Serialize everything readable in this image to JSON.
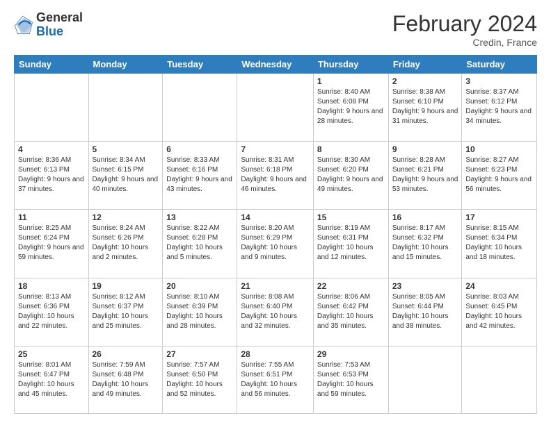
{
  "header": {
    "logo_general": "General",
    "logo_blue": "Blue",
    "month_year": "February 2024",
    "location": "Credin, France"
  },
  "days_of_week": [
    "Sunday",
    "Monday",
    "Tuesday",
    "Wednesday",
    "Thursday",
    "Friday",
    "Saturday"
  ],
  "weeks": [
    [
      {
        "day": "",
        "info": ""
      },
      {
        "day": "",
        "info": ""
      },
      {
        "day": "",
        "info": ""
      },
      {
        "day": "",
        "info": ""
      },
      {
        "day": "1",
        "info": "Sunrise: 8:40 AM\nSunset: 6:08 PM\nDaylight: 9 hours and 28 minutes."
      },
      {
        "day": "2",
        "info": "Sunrise: 8:38 AM\nSunset: 6:10 PM\nDaylight: 9 hours and 31 minutes."
      },
      {
        "day": "3",
        "info": "Sunrise: 8:37 AM\nSunset: 6:12 PM\nDaylight: 9 hours and 34 minutes."
      }
    ],
    [
      {
        "day": "4",
        "info": "Sunrise: 8:36 AM\nSunset: 6:13 PM\nDaylight: 9 hours and 37 minutes."
      },
      {
        "day": "5",
        "info": "Sunrise: 8:34 AM\nSunset: 6:15 PM\nDaylight: 9 hours and 40 minutes."
      },
      {
        "day": "6",
        "info": "Sunrise: 8:33 AM\nSunset: 6:16 PM\nDaylight: 9 hours and 43 minutes."
      },
      {
        "day": "7",
        "info": "Sunrise: 8:31 AM\nSunset: 6:18 PM\nDaylight: 9 hours and 46 minutes."
      },
      {
        "day": "8",
        "info": "Sunrise: 8:30 AM\nSunset: 6:20 PM\nDaylight: 9 hours and 49 minutes."
      },
      {
        "day": "9",
        "info": "Sunrise: 8:28 AM\nSunset: 6:21 PM\nDaylight: 9 hours and 53 minutes."
      },
      {
        "day": "10",
        "info": "Sunrise: 8:27 AM\nSunset: 6:23 PM\nDaylight: 9 hours and 56 minutes."
      }
    ],
    [
      {
        "day": "11",
        "info": "Sunrise: 8:25 AM\nSunset: 6:24 PM\nDaylight: 9 hours and 59 minutes."
      },
      {
        "day": "12",
        "info": "Sunrise: 8:24 AM\nSunset: 6:26 PM\nDaylight: 10 hours and 2 minutes."
      },
      {
        "day": "13",
        "info": "Sunrise: 8:22 AM\nSunset: 6:28 PM\nDaylight: 10 hours and 5 minutes."
      },
      {
        "day": "14",
        "info": "Sunrise: 8:20 AM\nSunset: 6:29 PM\nDaylight: 10 hours and 9 minutes."
      },
      {
        "day": "15",
        "info": "Sunrise: 8:19 AM\nSunset: 6:31 PM\nDaylight: 10 hours and 12 minutes."
      },
      {
        "day": "16",
        "info": "Sunrise: 8:17 AM\nSunset: 6:32 PM\nDaylight: 10 hours and 15 minutes."
      },
      {
        "day": "17",
        "info": "Sunrise: 8:15 AM\nSunset: 6:34 PM\nDaylight: 10 hours and 18 minutes."
      }
    ],
    [
      {
        "day": "18",
        "info": "Sunrise: 8:13 AM\nSunset: 6:36 PM\nDaylight: 10 hours and 22 minutes."
      },
      {
        "day": "19",
        "info": "Sunrise: 8:12 AM\nSunset: 6:37 PM\nDaylight: 10 hours and 25 minutes."
      },
      {
        "day": "20",
        "info": "Sunrise: 8:10 AM\nSunset: 6:39 PM\nDaylight: 10 hours and 28 minutes."
      },
      {
        "day": "21",
        "info": "Sunrise: 8:08 AM\nSunset: 6:40 PM\nDaylight: 10 hours and 32 minutes."
      },
      {
        "day": "22",
        "info": "Sunrise: 8:06 AM\nSunset: 6:42 PM\nDaylight: 10 hours and 35 minutes."
      },
      {
        "day": "23",
        "info": "Sunrise: 8:05 AM\nSunset: 6:44 PM\nDaylight: 10 hours and 38 minutes."
      },
      {
        "day": "24",
        "info": "Sunrise: 8:03 AM\nSunset: 6:45 PM\nDaylight: 10 hours and 42 minutes."
      }
    ],
    [
      {
        "day": "25",
        "info": "Sunrise: 8:01 AM\nSunset: 6:47 PM\nDaylight: 10 hours and 45 minutes."
      },
      {
        "day": "26",
        "info": "Sunrise: 7:59 AM\nSunset: 6:48 PM\nDaylight: 10 hours and 49 minutes."
      },
      {
        "day": "27",
        "info": "Sunrise: 7:57 AM\nSunset: 6:50 PM\nDaylight: 10 hours and 52 minutes."
      },
      {
        "day": "28",
        "info": "Sunrise: 7:55 AM\nSunset: 6:51 PM\nDaylight: 10 hours and 56 minutes."
      },
      {
        "day": "29",
        "info": "Sunrise: 7:53 AM\nSunset: 6:53 PM\nDaylight: 10 hours and 59 minutes."
      },
      {
        "day": "",
        "info": ""
      },
      {
        "day": "",
        "info": ""
      }
    ]
  ]
}
